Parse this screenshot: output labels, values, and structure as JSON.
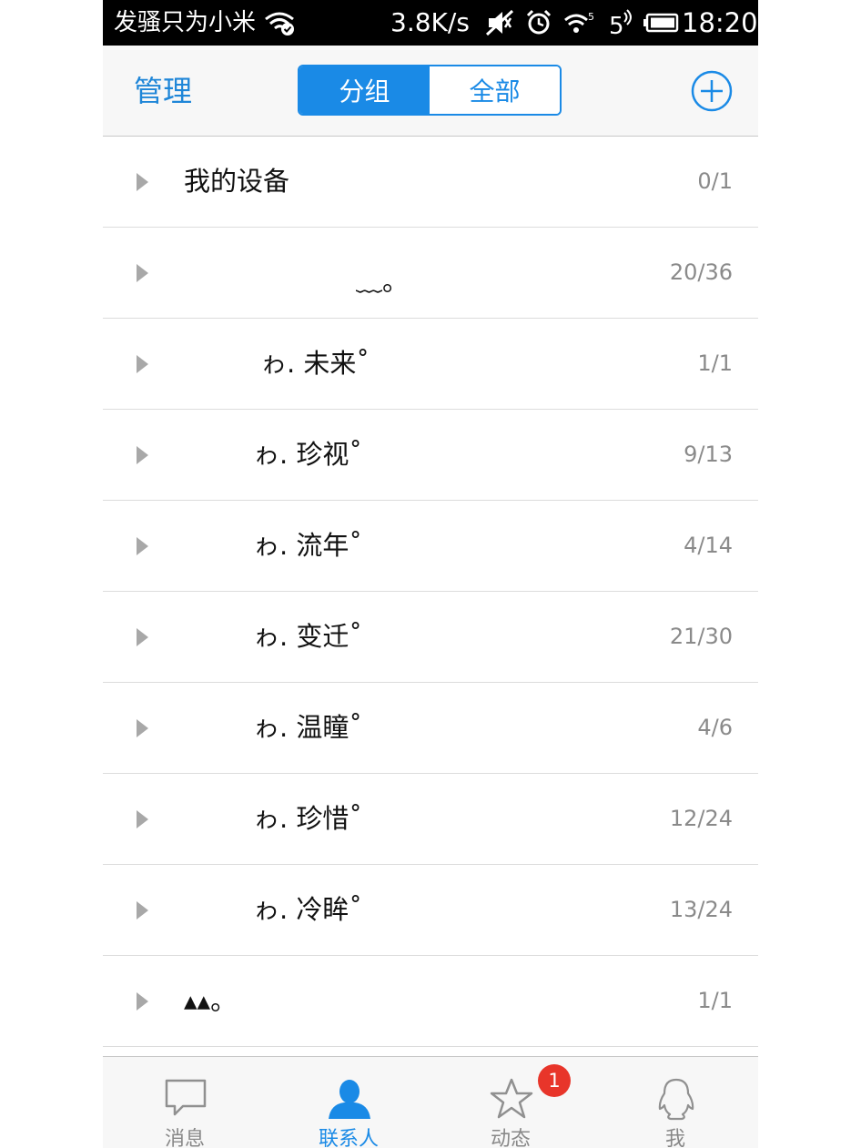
{
  "status_bar": {
    "carrier": "发骚只为小米",
    "net_speed": "3.8K/s",
    "time": "18:20",
    "icons": [
      "wifi-check-icon",
      "mute-icon",
      "alarm-icon",
      "wifi-signal-icon",
      "signal-5-icon",
      "battery-icon"
    ]
  },
  "nav": {
    "manage_label": "管理",
    "segments": [
      {
        "label": "分组",
        "active": true
      },
      {
        "label": "全部",
        "active": false
      }
    ],
    "add_icon": "plus-circle-icon"
  },
  "groups": [
    {
      "name": "我的设备",
      "count": "0/1"
    },
    {
      "name": "﹏。",
      "count": "20/36"
    },
    {
      "name": "ゎ. 未来˚",
      "count": "1/1"
    },
    {
      "name": "ゎ. 珍视˚",
      "count": "9/13"
    },
    {
      "name": "ゎ. 流年˚",
      "count": "4/14"
    },
    {
      "name": "ゎ. 变迁˚",
      "count": "21/30"
    },
    {
      "name": "ゎ. 温瞳˚",
      "count": "4/6"
    },
    {
      "name": "ゎ. 珍惜˚",
      "count": "12/24"
    },
    {
      "name": "ゎ. 冷眸˚",
      "count": "13/24"
    },
    {
      "name": "▴▴。",
      "count": "1/1"
    }
  ],
  "tabs": [
    {
      "label": "消息",
      "icon": "message-bubble-icon",
      "active": false
    },
    {
      "label": "联系人",
      "icon": "person-icon",
      "active": true
    },
    {
      "label": "动态",
      "icon": "star-icon",
      "active": false,
      "badge": "1"
    },
    {
      "label": "我",
      "icon": "penguin-icon",
      "active": false
    }
  ],
  "colors": {
    "accent": "#1a8ae6",
    "badge": "#e8352a",
    "count_text": "#8a8a8a"
  }
}
